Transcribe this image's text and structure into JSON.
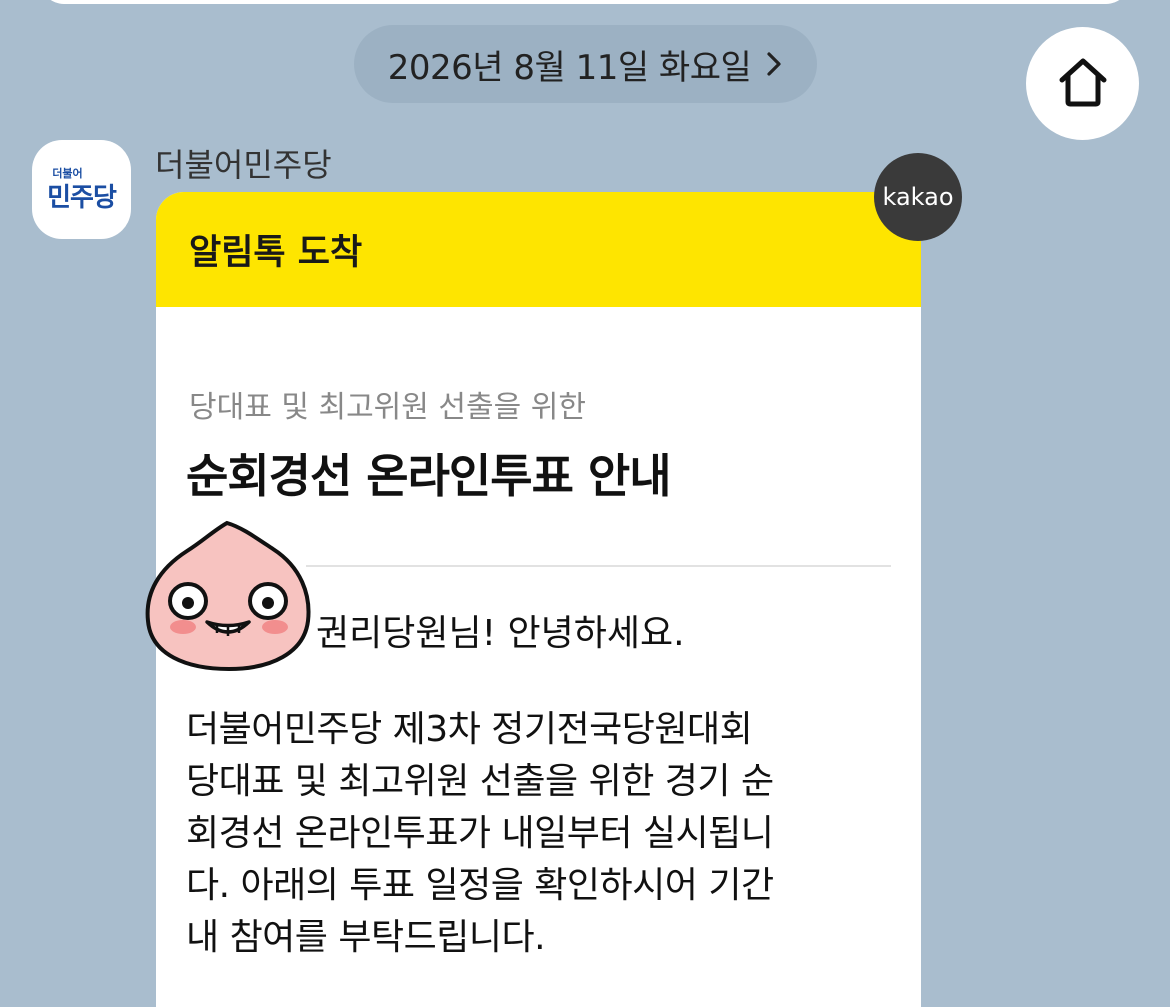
{
  "header": {
    "date_label": "2026년 8월 11일 화요일"
  },
  "sender": {
    "name": "더불어민주당",
    "avatar_small": "더불어",
    "avatar_big": "민주당"
  },
  "message": {
    "header_title": "알림톡 도착",
    "badge": "kakao",
    "subtitle": "당대표 및 최고위원 선출을 위한",
    "title": "순회경선 온라인투표 안내",
    "greeting": "권리당원님! 안녕하세요.",
    "body": "더불어민주당 제3차 정기전국당원대회\n당대표 및 최고위원 선출을 위한 경기 순\n회경선 온라인투표가 내일부터 실시됩니\n다. 아래의 투표 일정을 확인하시어 기간\n 내 참여를 부탁드립니다."
  },
  "icons": {
    "home": "home-icon",
    "chevron": "chevron-right-icon",
    "sticker": "peach-sticker"
  },
  "colors": {
    "background": "#a9bdce",
    "header_yellow": "#fee500",
    "party_blue": "#1b4ea3",
    "sticker_pink": "#f7c3c0"
  }
}
